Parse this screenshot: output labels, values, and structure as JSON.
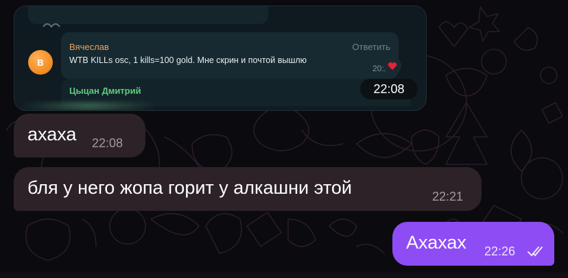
{
  "screenshot_card": {
    "avatar_initial": "В",
    "sender": "Вячеслав",
    "reply_label": "Ответить",
    "message_text": "WTB KILLs osc, 1 kills=100 gold. Мне скрин и почтой вышлю",
    "message_time": "20:20",
    "reaction": "heart",
    "second_sender": "Цыцан Дмитрий",
    "time_badge": "22:08"
  },
  "messages": [
    {
      "text": "ахаха",
      "time": "22:08",
      "direction": "incoming"
    },
    {
      "text": "бля у него жопа горит у алкашни этой",
      "time": "22:21",
      "direction": "incoming"
    },
    {
      "text": "Ахахах",
      "time": "22:26",
      "direction": "outgoing",
      "status": "read"
    }
  ],
  "colors": {
    "background": "#0b0a0e",
    "incoming_bubble": "#2c2227",
    "outgoing_bubble": "#8e4cf5",
    "sender_name": "#f0a05a",
    "second_sender_name": "#5fcc7f",
    "avatar": "#f08a1d"
  }
}
